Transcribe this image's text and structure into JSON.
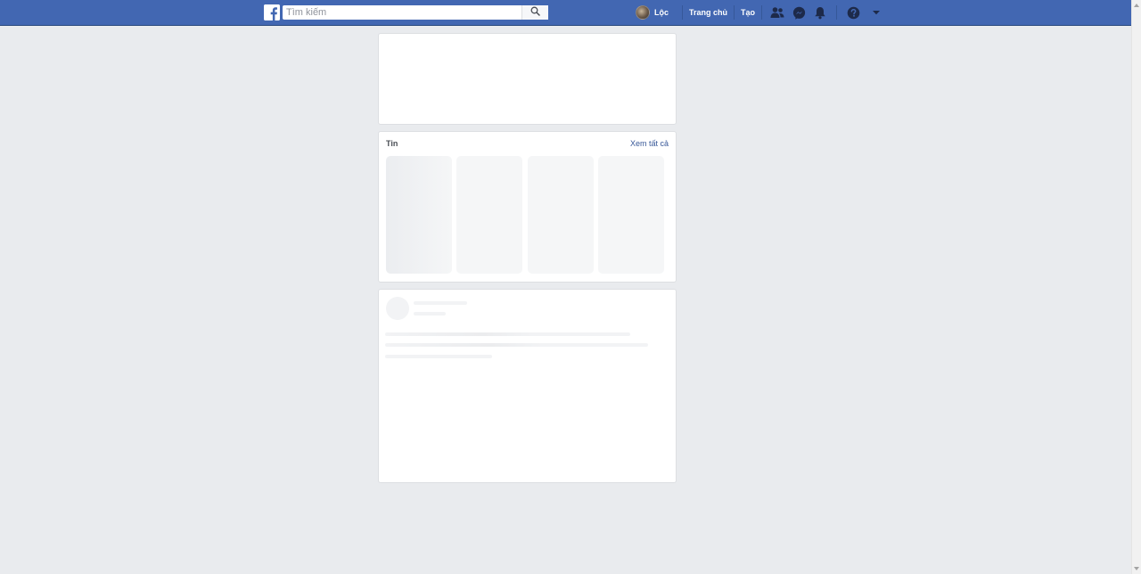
{
  "app": {
    "brand_icon": "facebook-logo-icon",
    "brand_color": "#4267b2",
    "background_color": "#e9ebee"
  },
  "search": {
    "placeholder": "Tìm kiếm",
    "value": "",
    "icon": "search-icon"
  },
  "nav": {
    "profile_name": "Lộc",
    "home_label": "Trang chủ",
    "create_label": "Tạo",
    "icons": [
      "friend-requests-icon",
      "messenger-icon",
      "notifications-icon",
      "help-icon",
      "account-menu-caret-icon"
    ]
  },
  "stories": {
    "title": "Tin",
    "see_all_label": "Xem tất cả",
    "tile_count": 4
  }
}
